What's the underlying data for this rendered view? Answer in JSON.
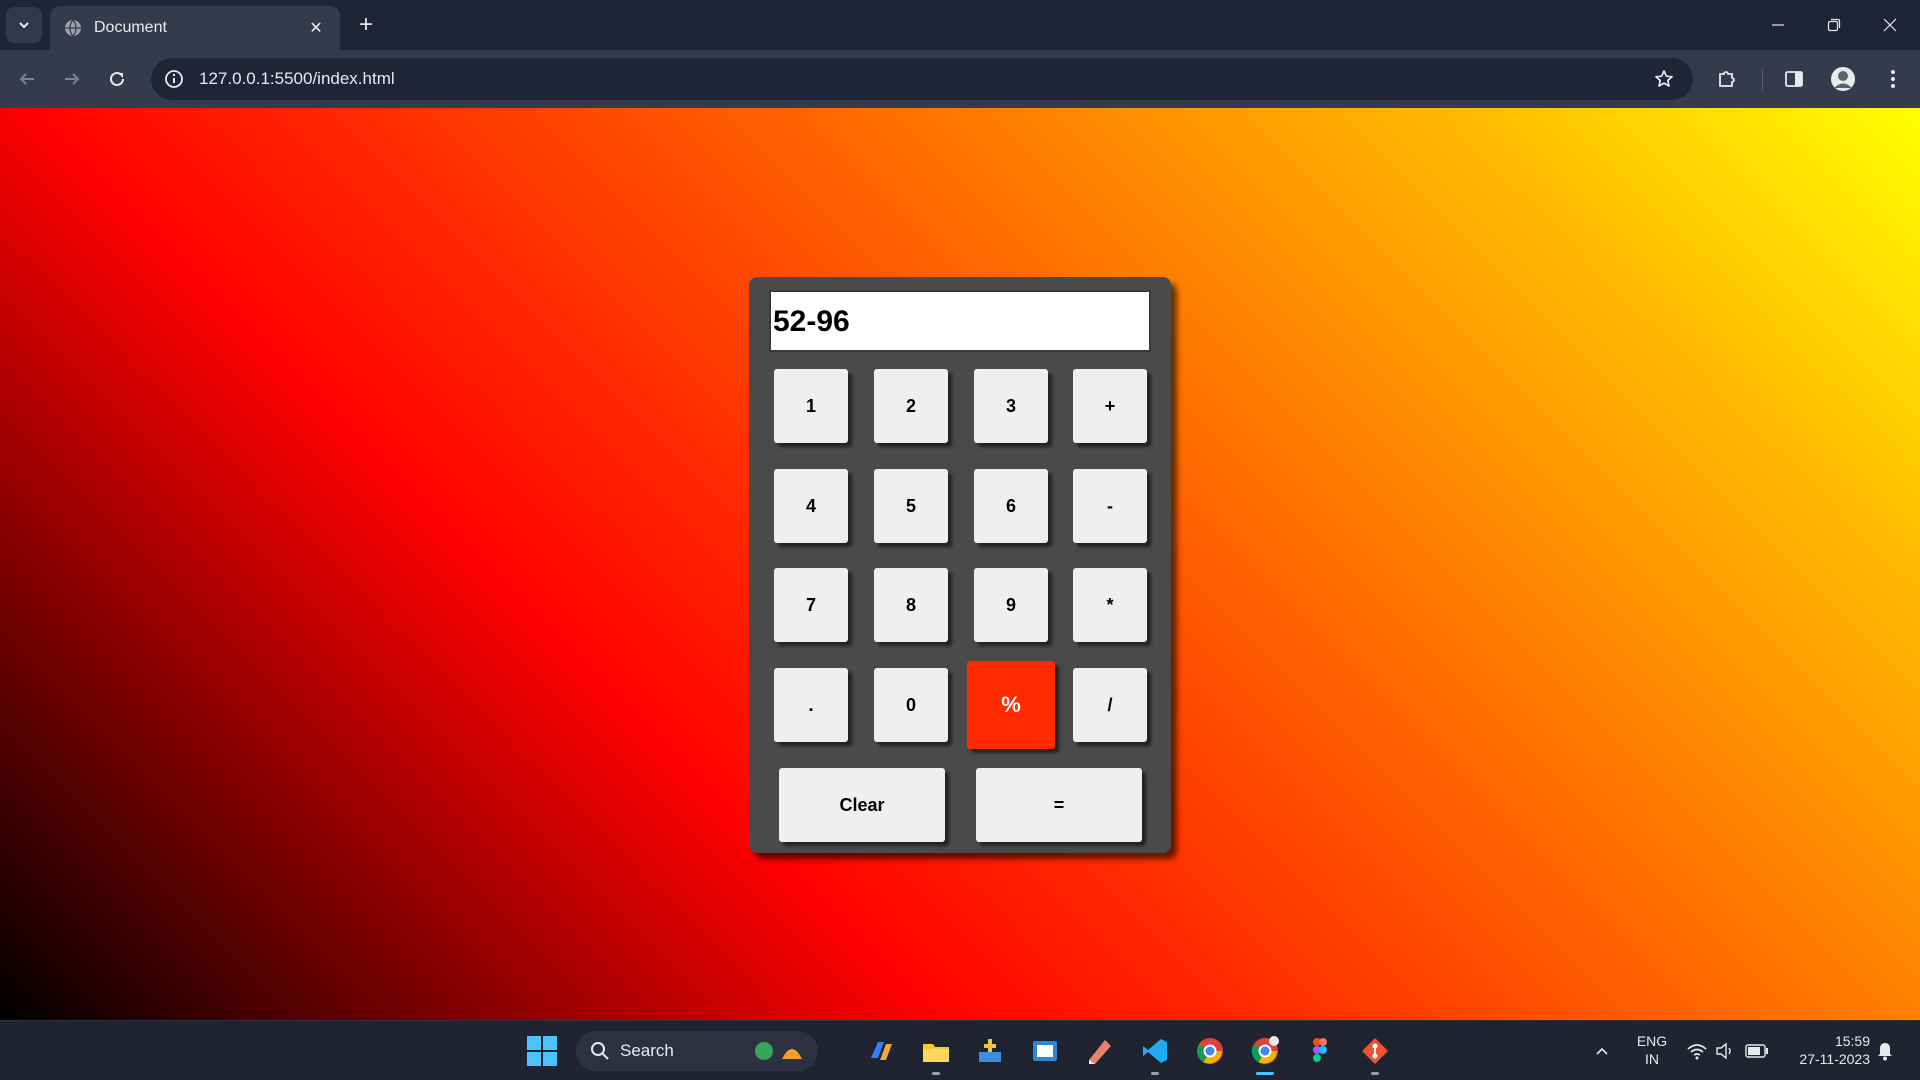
{
  "browser": {
    "tab_title": "Document",
    "tab_close": "✕",
    "new_tab": "+",
    "url": "127.0.0.1:5500/index.html"
  },
  "calculator": {
    "display": "52-96",
    "keys": [
      "1",
      "2",
      "3",
      "+",
      "4",
      "5",
      "6",
      "-",
      "7",
      "8",
      "9",
      "*",
      ".",
      "0",
      "%",
      "/"
    ],
    "clear_label": "Clear",
    "equals_label": "=",
    "active_key": "%",
    "colors": {
      "body": "#4a4a4a",
      "key": "#efefef",
      "active_key": "#ff2a00"
    }
  },
  "page": {
    "gradient_colors": [
      "#000000",
      "#ff0000",
      "#ff6a00",
      "#ffc000",
      "#ffff00"
    ]
  },
  "taskbar": {
    "search_label": "Search",
    "lang_line1": "ENG",
    "lang_line2": "IN",
    "time": "15:59",
    "date": "27-11-2023",
    "apps": [
      "copilot-icon",
      "file-explorer-icon",
      "app-icon",
      "store-icon",
      "paint-icon",
      "vscode-icon",
      "chrome-icon",
      "chrome-active-icon",
      "figma-icon",
      "git-icon"
    ]
  }
}
